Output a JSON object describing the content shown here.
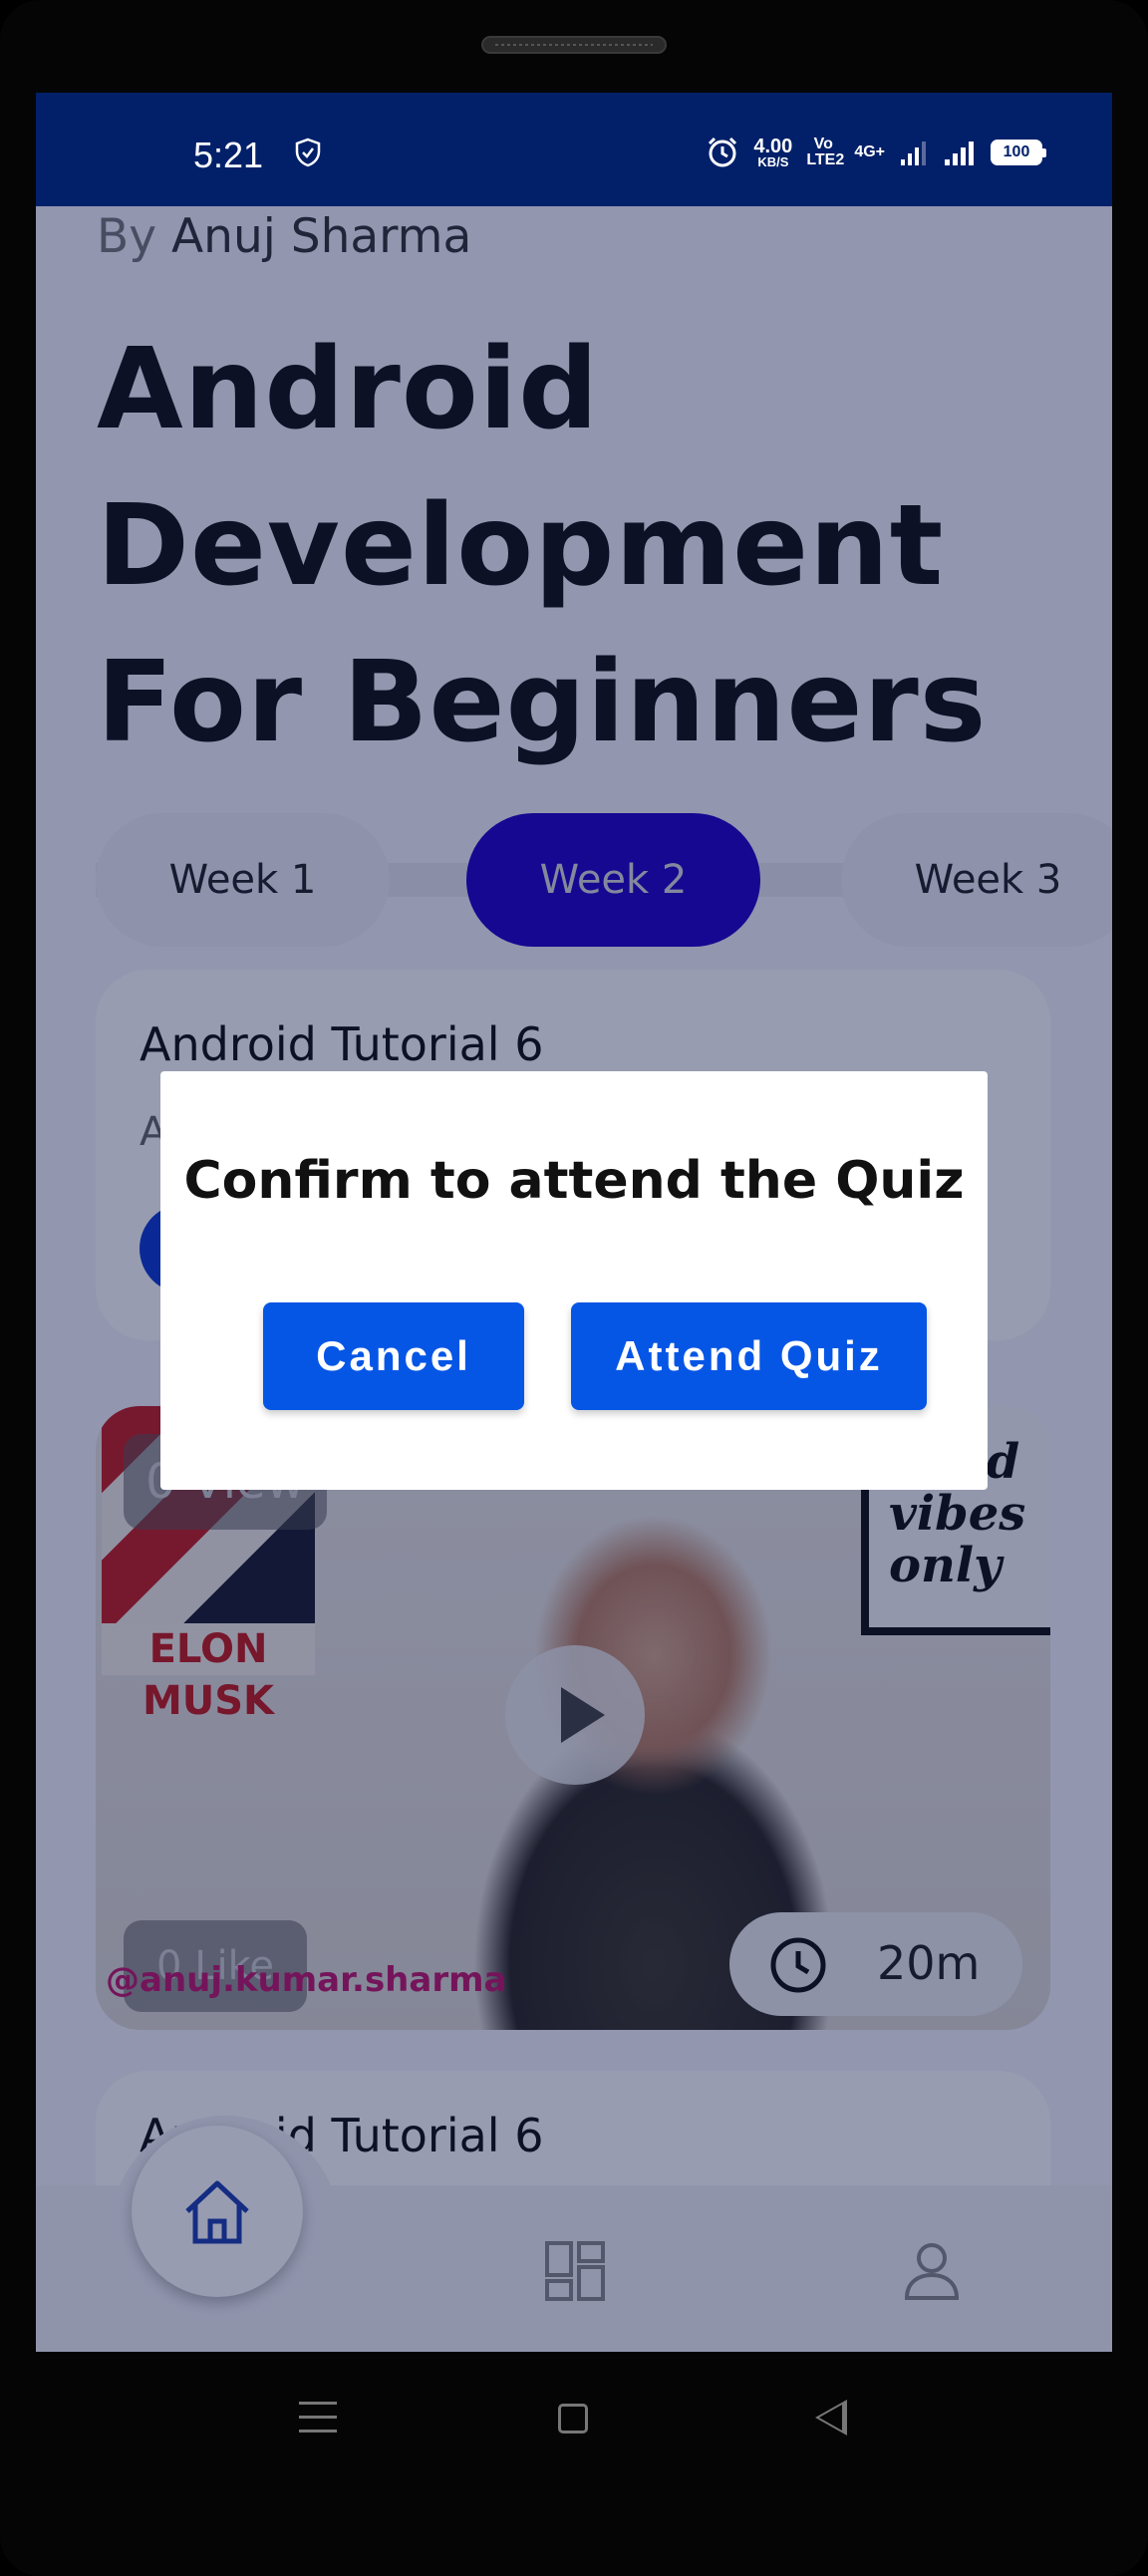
{
  "status_bar": {
    "time": "5:21",
    "net_speed": "4.00",
    "net_unit": "KB/S",
    "volte": "Vo LTE2",
    "network": "4G+",
    "battery": "100"
  },
  "course": {
    "author_prefix": "By",
    "author_name": "Anuj Sharma",
    "title": "Android Development For Beginners"
  },
  "weeks": [
    {
      "label": "Week 1",
      "active": false
    },
    {
      "label": "Week 2",
      "active": true
    },
    {
      "label": "Week 3",
      "active": false
    }
  ],
  "card1": {
    "title": "Android Tutorial 6",
    "subtitle": "A"
  },
  "video": {
    "views": "0 View",
    "likes": "0 Like",
    "duration": "20m",
    "poster_text": "ELON MUSK",
    "frame_text": "good vibes only",
    "watermark": "@anuj.kumar.sharma"
  },
  "card2": {
    "title": "Android Tutorial 6"
  },
  "dialog": {
    "message": "Confirm to attend the Quiz",
    "cancel_label": "Cancel",
    "confirm_label": "Attend Quiz"
  },
  "bottom_nav": [
    "home-icon",
    "dashboard-icon",
    "profile-icon"
  ],
  "colors": {
    "status_bar": "#012069",
    "active_week": "#2200c8",
    "dialog_button": "#0656e6",
    "nav_icon": "#1c3fae"
  }
}
